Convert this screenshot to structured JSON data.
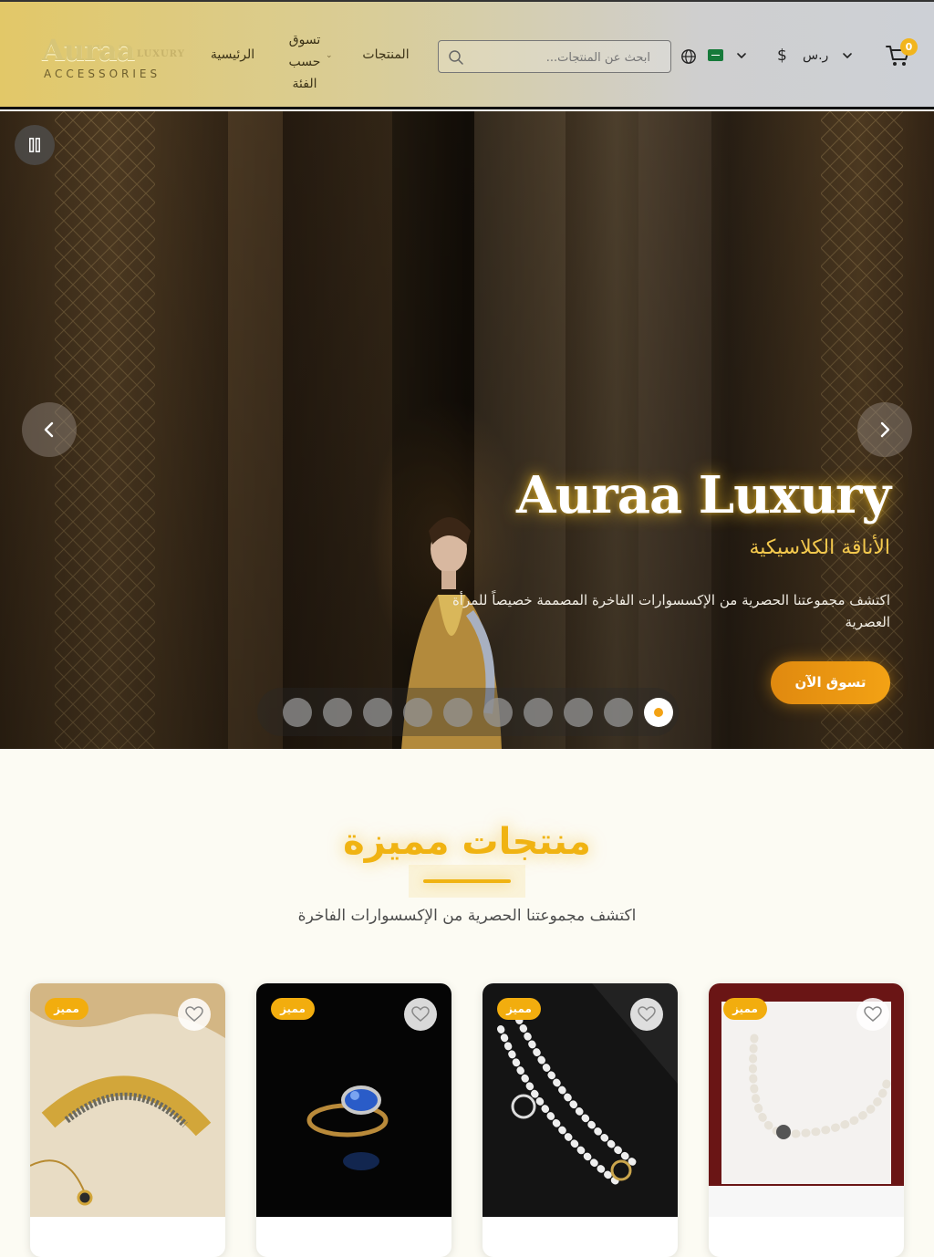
{
  "header": {
    "logo": {
      "main": "Auraa",
      "sub": "LUXURY",
      "tagline": "ACCESSORIES"
    },
    "nav": {
      "home": "الرئيسية",
      "categories": "تسوق حسب الفئة",
      "products": "المنتجات"
    },
    "search": {
      "placeholder": "ابحث عن المنتجات...",
      "value": ""
    },
    "language": {
      "flag": "saudi-arabia-flag"
    },
    "currency": {
      "symbol": "$",
      "label": "ر.س"
    },
    "cart": {
      "count": "0"
    }
  },
  "hero": {
    "title": "Auraa Luxury",
    "subtitle": "الأناقة الكلاسيكية",
    "description": "اكتشف مجموعتنا الحصرية من الإكسسوارات الفاخرة المصممة خصيصاً للمرأة العصرية",
    "cta": "تسوق الآن",
    "slide_count": 10,
    "active_slide": 10
  },
  "featured": {
    "title": "منتجات مميزة",
    "subtitle": "اكتشف مجموعتنا الحصرية من الإكسسوارات الفاخرة",
    "products": [
      {
        "badge": "مميز",
        "name": ""
      },
      {
        "badge": "مميز",
        "name": ""
      },
      {
        "badge": "مميز",
        "name": ""
      },
      {
        "badge": "مميز",
        "name": ""
      }
    ]
  },
  "colors": {
    "accent": "#f2ad0e",
    "cta": "#f3a214",
    "header_gold": "#e2c868"
  },
  "icons": [
    "search-icon",
    "globe-icon",
    "chevron-down-icon",
    "dollar-icon",
    "cart-icon",
    "pause-icon",
    "chevron-left-icon",
    "chevron-right-icon",
    "heart-icon"
  ]
}
